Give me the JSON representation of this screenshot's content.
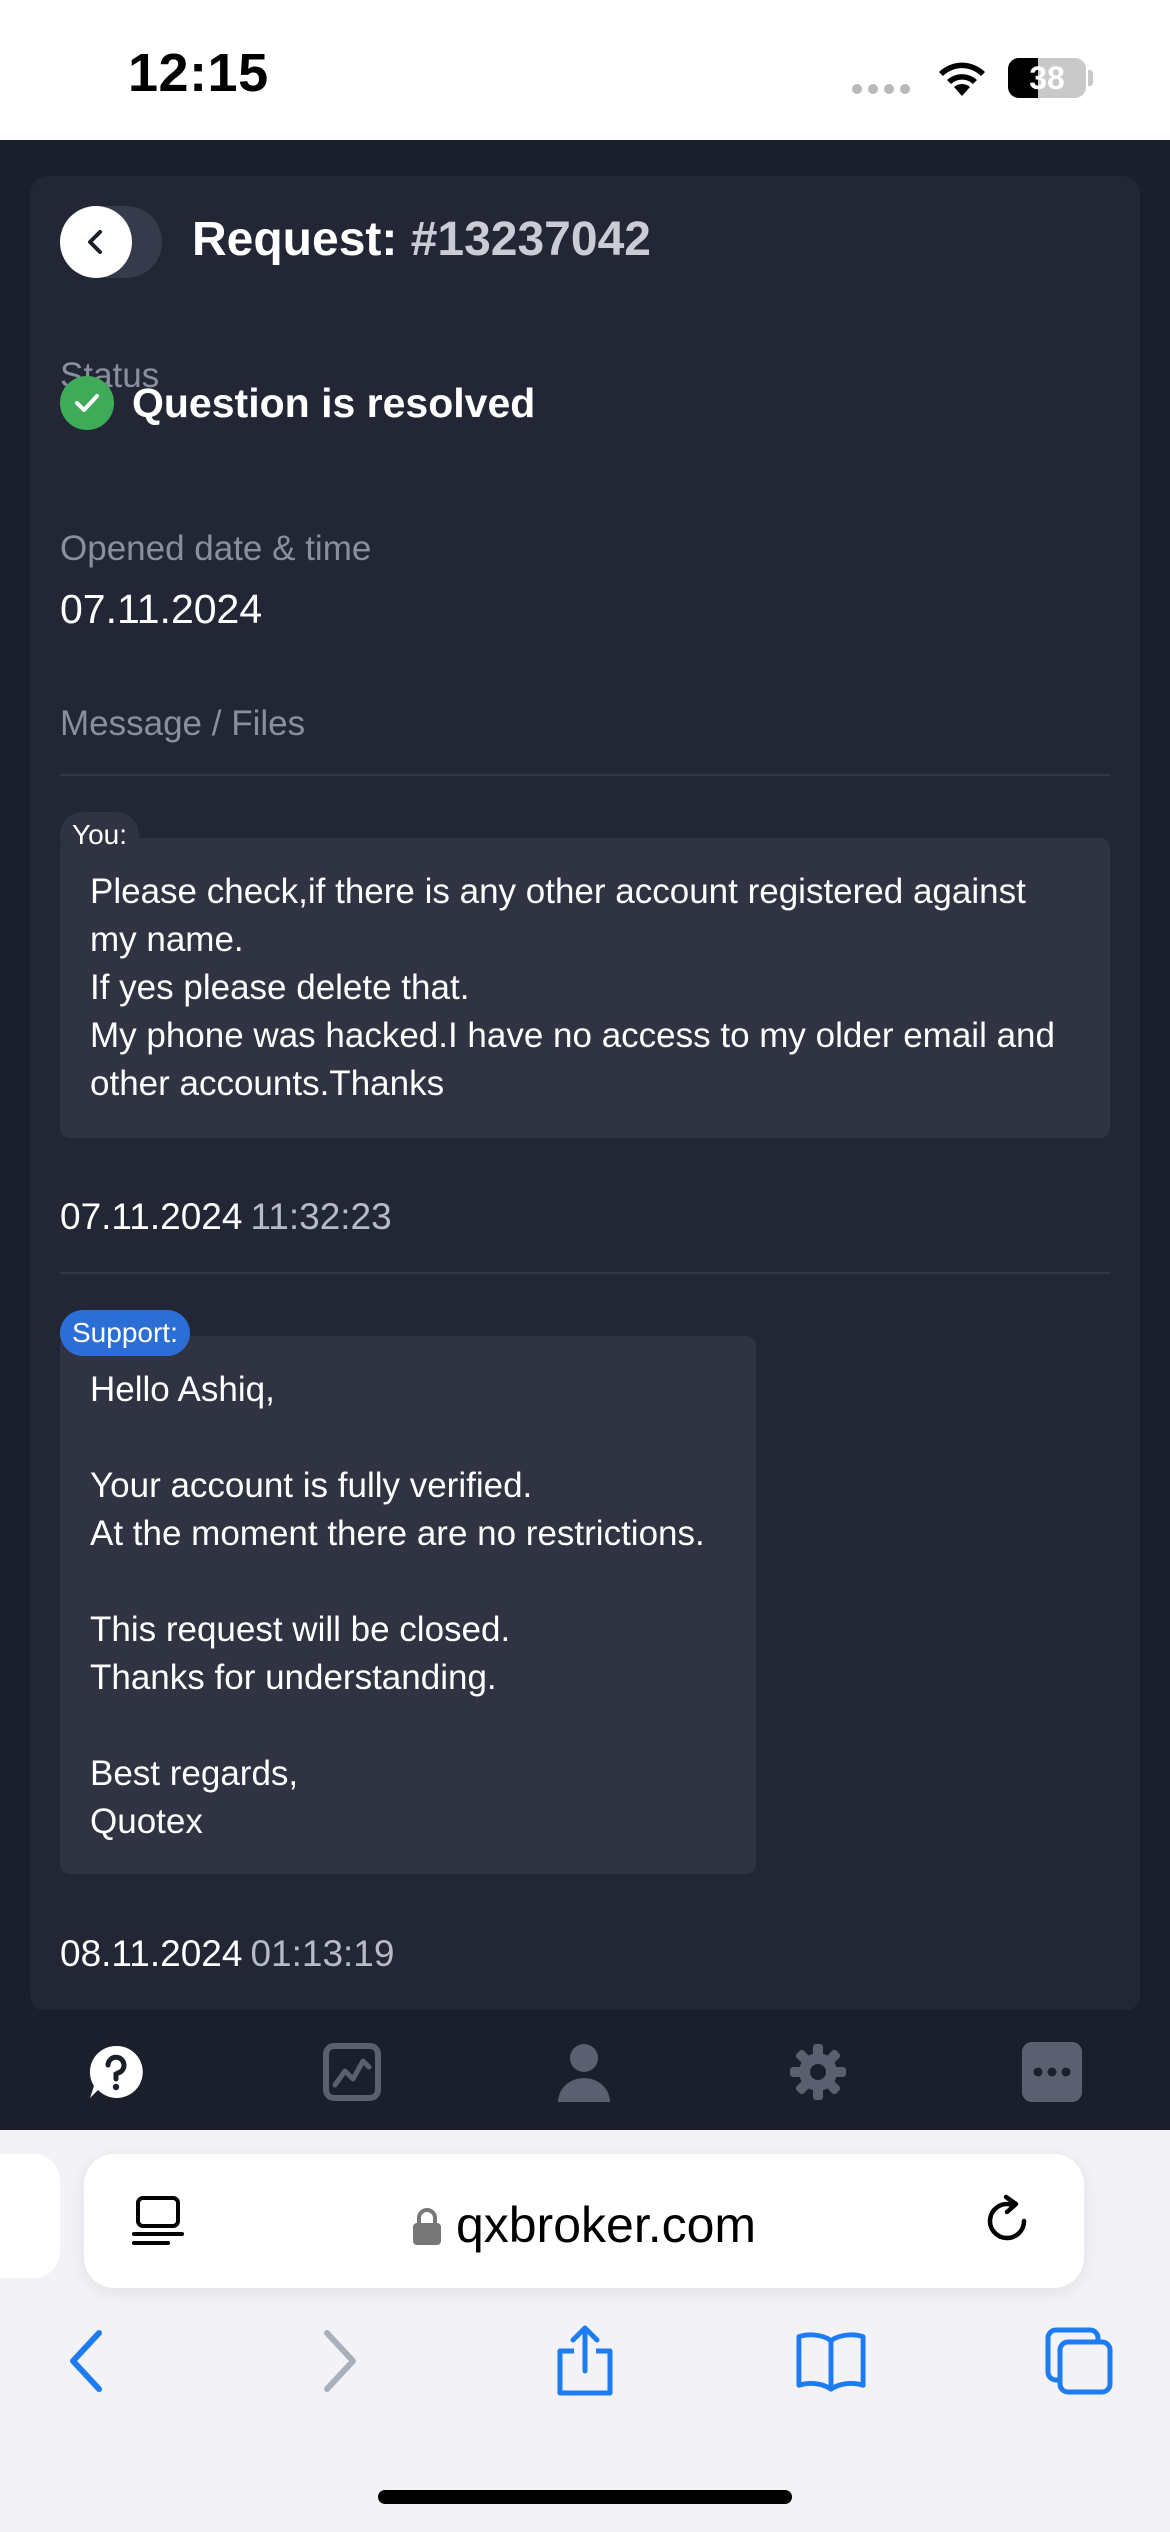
{
  "status_bar": {
    "time": "12:15",
    "battery_level": "38",
    "battery_fraction": 0.38
  },
  "request": {
    "title_prefix": "Request:",
    "number": "#13237042",
    "status_label": "Status",
    "status_value": "Question is resolved",
    "opened_label": "Opened date & time",
    "opened_value": "07.11.2024",
    "messages_label": "Message / Files"
  },
  "messages": [
    {
      "sender": "You:",
      "text": "Please check,if there is any other account registered against my name.\nIf yes please delete that.\nMy phone was hacked.I have no access to my older email and other accounts.Thanks",
      "date": "07.11.2024",
      "time": "11:32:23"
    },
    {
      "sender": "Support:",
      "text": "Hello Ashiq,\n\nYour account is fully verified.\nAt the moment there are no restrictions.\n\nThis request will be closed.\nThanks for understanding.\n\nBest regards,\nQuotex",
      "date": "08.11.2024",
      "time": "01:13:19"
    }
  ],
  "app_tabs": [
    {
      "name": "help",
      "icon": "question-bubble-icon",
      "active": true
    },
    {
      "name": "trading",
      "icon": "chart-icon",
      "active": false
    },
    {
      "name": "profile",
      "icon": "user-icon",
      "active": false
    },
    {
      "name": "settings",
      "icon": "gear-icon",
      "active": false
    },
    {
      "name": "more",
      "icon": "more-icon",
      "active": false
    }
  ],
  "browser": {
    "url": "qxbroker.com"
  },
  "colors": {
    "background": "#1b1f2b",
    "card": "#232735",
    "bubble": "#2f3342",
    "success": "#3dab57",
    "support_tag": "#2b6fd6",
    "safari_blue": "#1d7cf2"
  }
}
